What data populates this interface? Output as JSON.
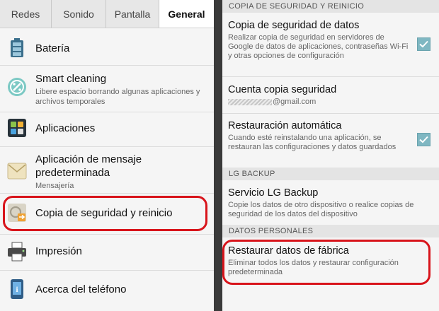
{
  "left": {
    "tabs": [
      "Redes",
      "Sonido",
      "Pantalla",
      "General"
    ],
    "active_tab": "General",
    "items": [
      {
        "title": "Batería",
        "subtitle": "",
        "icon": "battery-icon"
      },
      {
        "title": "Smart cleaning",
        "subtitle": "Libere espacio borrando algunas aplicaciones y archivos temporales",
        "icon": "smart-cleaning-icon"
      },
      {
        "title": "Aplicaciones",
        "subtitle": "",
        "icon": "apps-icon"
      },
      {
        "title": "Aplicación de mensaje predeterminada",
        "subtitle": "Mensajería",
        "icon": "message-app-icon"
      },
      {
        "title": "Copia de seguridad y reinicio",
        "subtitle": "",
        "icon": "backup-reset-icon"
      },
      {
        "title": "Impresión",
        "subtitle": "",
        "icon": "printer-icon"
      },
      {
        "title": "Acerca del teléfono",
        "subtitle": "",
        "icon": "about-phone-icon"
      }
    ]
  },
  "right": {
    "sections": [
      {
        "header": "COPIA DE SEGURIDAD Y REINICIO",
        "items": [
          {
            "title": "Copia de seguridad de datos",
            "subtitle": "Realizar copia de seguridad en servidores de Google de datos de aplicaciones, contraseñas Wi-Fi y otras opciones de configuración",
            "checked": true
          },
          {
            "title": "Cuenta copia seguridad",
            "subtitle": "@gmail.com"
          },
          {
            "title": "Restauración automática",
            "subtitle": "Cuando esté reinstalando una aplicación, se restauran las configuraciones y datos guardados",
            "checked": true
          }
        ]
      },
      {
        "header": "LG BACKUP",
        "items": [
          {
            "title": "Servicio LG Backup",
            "subtitle": "Copie los datos de otro dispositivo o realice copias de seguridad de los datos del dispositivo"
          }
        ]
      },
      {
        "header": "DATOS PERSONALES",
        "items": [
          {
            "title": "Restaurar datos de fábrica",
            "subtitle": "Eliminar todos los datos y restaurar configuración predeterminada"
          }
        ]
      }
    ]
  },
  "colors": {
    "highlight": "#d8141b",
    "checkbox": "#7fb7c2",
    "header_bg": "#e4e4e4"
  }
}
